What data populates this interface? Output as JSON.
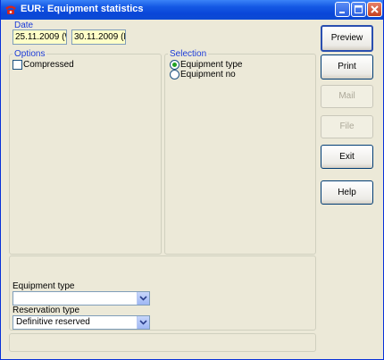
{
  "window": {
    "title": "EUR: Equipment statistics",
    "accent": "#0a46d8"
  },
  "date_group": {
    "label": "Date",
    "from": "25.11.2009 (W",
    "to": "30.11.2009 (M"
  },
  "options_group": {
    "label": "Options",
    "compressed_label": "Compressed",
    "compressed_checked": false
  },
  "selection_group": {
    "label": "Selection",
    "items": [
      {
        "label": "Equipment type",
        "selected": true
      },
      {
        "label": "Equipment no",
        "selected": false
      }
    ]
  },
  "filters": {
    "equipment_type_label": "Equipment type",
    "equipment_type_value": "",
    "reservation_type_label": "Reservation type",
    "reservation_type_value": "Definitive reserved"
  },
  "buttons": {
    "preview": "Preview",
    "print": "Print",
    "mail": "Mail",
    "file": "File",
    "exit": "Exit",
    "help": "Help"
  }
}
